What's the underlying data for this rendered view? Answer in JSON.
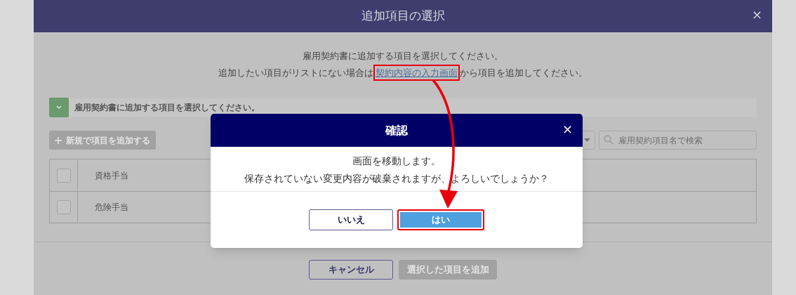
{
  "modal": {
    "title": "追加項目の選択",
    "close": "×",
    "intro": "雇用契約書に追加する項目を選択してください。",
    "intro_link_line": {
      "before": "追加したい項目がリストにない場合は",
      "link": "契約内容の入力画面",
      "link_highlighted": true,
      "after": "から項目を追加してください。"
    },
    "section": {
      "label": "雇用契約書に追加する項目を選択してください。",
      "expanded": true
    },
    "add_button": {
      "label": "新規で項目を追加する",
      "disabled": true
    },
    "search": {
      "placeholder": "雇用契約項目名で検索"
    },
    "rows": [
      {
        "name": "資格手当",
        "checked": false
      },
      {
        "name": "危険手当",
        "checked": false
      }
    ],
    "buttons": [
      {
        "label": "キャンセル",
        "disabled": false
      },
      {
        "label": "選択した項目を追加",
        "disabled": true
      }
    ]
  },
  "dialog": {
    "title": "確認",
    "close": "×",
    "message": [
      "画面を移動します。",
      "保存されていない変更内容が破棄されますが、よろしいでしょうか？"
    ],
    "buttons": [
      {
        "label": "いいえ",
        "kind": "secondary",
        "highlighted": false
      },
      {
        "label": "はい",
        "kind": "primary",
        "highlighted": true
      }
    ]
  }
}
